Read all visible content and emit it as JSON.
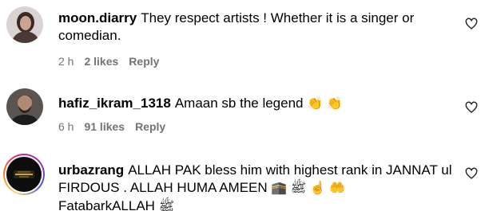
{
  "comments": [
    {
      "username": "moon.diarry",
      "text": "They respect artists ! Whether it is a singer or comedian.",
      "time": "2 h",
      "likes": "2 likes",
      "reply": "Reply"
    },
    {
      "username": "hafiz_ikram_1318",
      "text": "Amaan sb the legend",
      "emoji": "👏 👏",
      "time": "6 h",
      "likes": "91 likes",
      "reply": "Reply"
    },
    {
      "username": "urbazrang",
      "text": "ALLAH PAK bless him with highest rank in JANNAT ul FIRDOUS . ALLAH HUMA AMEEN",
      "emoji": "🕋 ﷺ ☝️ 🤲",
      "text2": "FatabarkALLAH",
      "emoji2": "ﷺ"
    }
  ],
  "icons": {
    "like": "heart-outline-icon"
  },
  "colors": {
    "meta_text": "#737373",
    "story_ring": "#d62976"
  }
}
